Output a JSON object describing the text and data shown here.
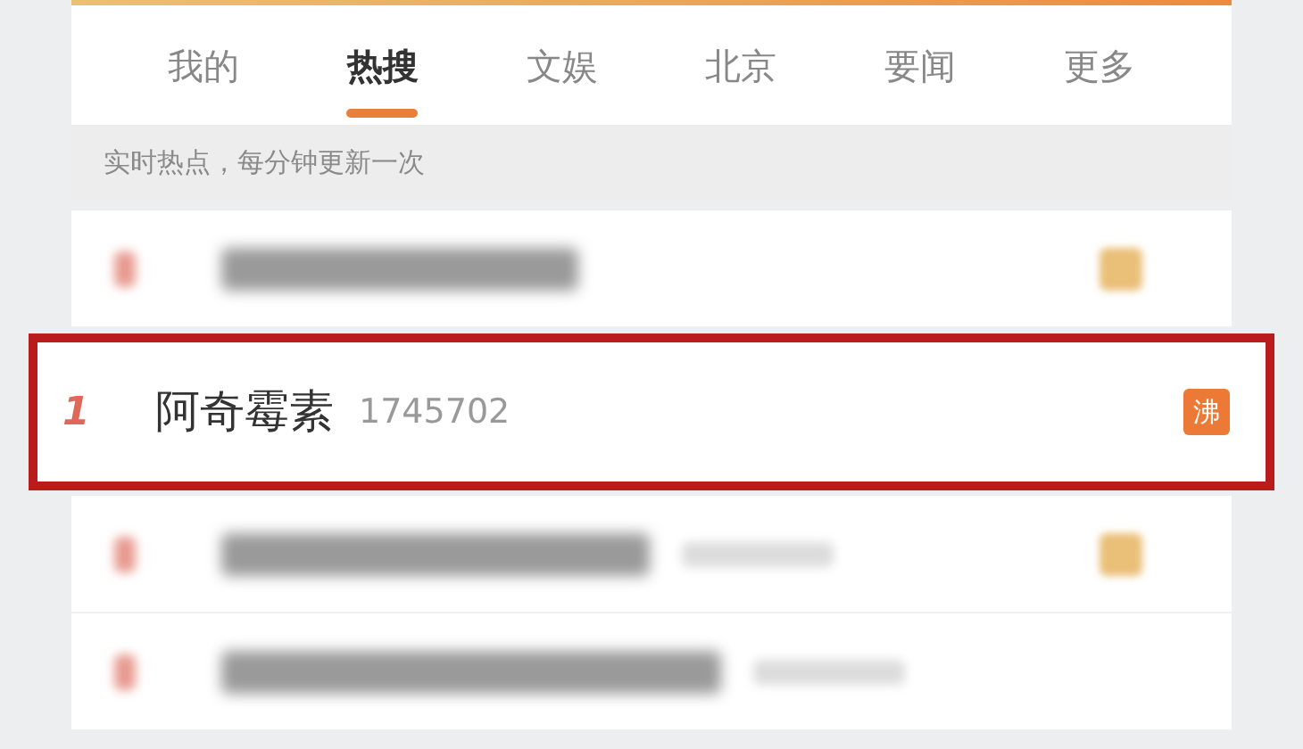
{
  "tabs": [
    {
      "label": "我的",
      "selected": false
    },
    {
      "label": "热搜",
      "selected": true
    },
    {
      "label": "文娱",
      "selected": false
    },
    {
      "label": "北京",
      "selected": false
    },
    {
      "label": "要闻",
      "selected": false
    },
    {
      "label": "更多",
      "selected": false
    }
  ],
  "subtitle": "实时热点，每分钟更新一次",
  "rows": [
    {
      "kind": "blurred",
      "badge": true,
      "count": false
    },
    {
      "kind": "highlighted",
      "rank": "1",
      "title": "阿奇霉素",
      "count": "1745702",
      "badge": "沸"
    },
    {
      "kind": "blurred",
      "badge": true,
      "count": true
    },
    {
      "kind": "blurred",
      "badge": false,
      "count": true
    }
  ]
}
